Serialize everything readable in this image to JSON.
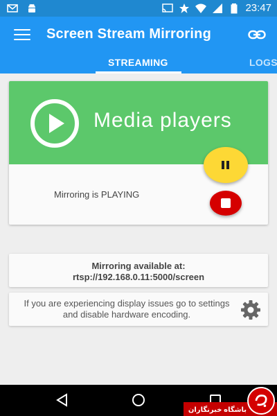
{
  "status_bar": {
    "time": "23:47",
    "left_icons": [
      "mail-icon",
      "android-icon"
    ],
    "right_icons": [
      "cast-icon",
      "star-icon",
      "wifi-icon",
      "signal-icon",
      "battery-icon"
    ]
  },
  "app_bar": {
    "title": "Screen Stream Mirroring",
    "menu_icon": "hamburger-menu-icon",
    "action_icon": "link-icon",
    "tabs": [
      {
        "label": "STREAMING",
        "active": true
      },
      {
        "label": "LOGS",
        "active": false
      }
    ],
    "color": "#2196f3"
  },
  "player_card": {
    "banner_text": "Media players",
    "banner_color": "#5cc86b",
    "status": "Mirroring is PLAYING",
    "pause_color": "#fdd835",
    "stop_color": "#d50000"
  },
  "info_card": {
    "line1": "Mirroring available at:",
    "line2": "rtsp://192.168.0.11:5000/screen"
  },
  "warning_card": {
    "text": "If you are experiencing display issues go to settings and disable hardware encoding."
  },
  "nav_bar": {
    "buttons": [
      "back-icon",
      "home-icon",
      "recents-icon"
    ]
  },
  "watermark": {
    "text": "باشگاه خبرنگاران"
  }
}
